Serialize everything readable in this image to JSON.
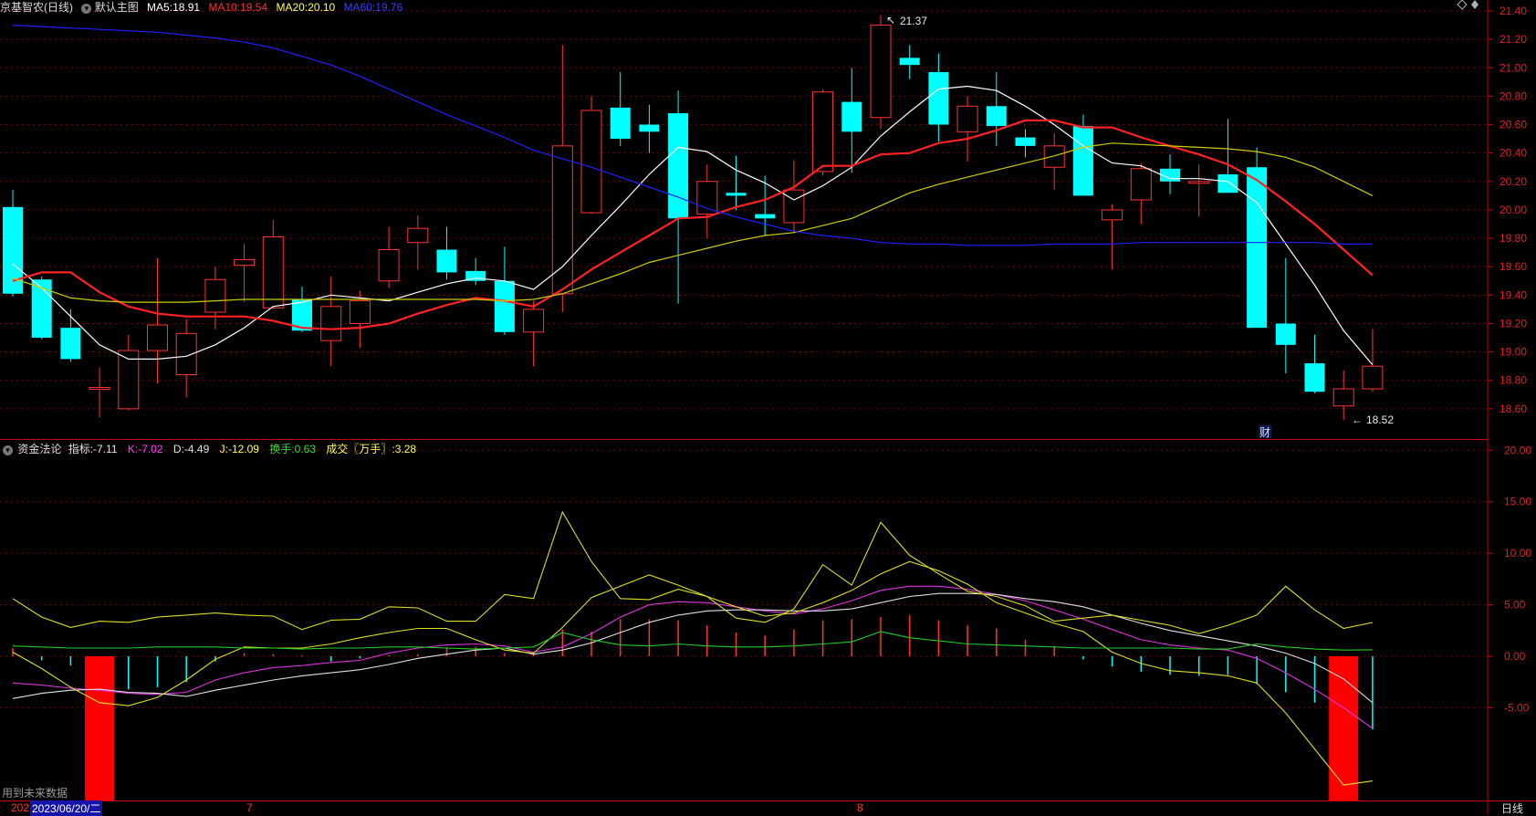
{
  "header": {
    "stock": "京基智农(日线)",
    "default_chart": "默认主图",
    "ma": [
      {
        "label": "MA5:",
        "value": "18.91",
        "color": "#ffffff"
      },
      {
        "label": "MA10:",
        "value": "19.54",
        "color": "#ff3030"
      },
      {
        "label": "MA20:",
        "value": "20.10",
        "color": "#ffff55"
      },
      {
        "label": "MA60:",
        "value": "19.76",
        "color": "#3a3aff"
      }
    ],
    "high_mark": "21.37",
    "low_mark": "18.52",
    "fin_badge": "财"
  },
  "indicator_header": {
    "name": "资金法论",
    "items": [
      {
        "label": "指标:",
        "value": "-7.11",
        "color": "#e0e0e0"
      },
      {
        "label": "K:",
        "value": "-7.02",
        "color": "#ff44ff"
      },
      {
        "label": "D:",
        "value": "-4.49",
        "color": "#e0e0e0"
      },
      {
        "label": "J:",
        "value": "-12.09",
        "color": "#ffff55"
      },
      {
        "label": "换手:",
        "value": "0.63",
        "color": "#33dd33"
      },
      {
        "label": "成交〖万手〗:",
        "value": "3.28",
        "color": "#ffff55"
      }
    ]
  },
  "footer": {
    "future_note": "用到未来数据",
    "cursor_date": "2023/06/20/二",
    "date_prefix": "202",
    "month_7": "7",
    "month_8": "8",
    "period": "日线"
  },
  "colors": {
    "up": "#ff3333",
    "down": "#00ffff",
    "grid": "#7a0000",
    "axis": "#cc0000",
    "label": "#dd2222"
  },
  "chart_data": [
    {
      "type": "candlestick",
      "ylim": [
        18.4,
        21.4
      ],
      "y_ticks": [
        "21.40",
        "21.20",
        "21.00",
        "20.80",
        "20.60",
        "20.40",
        "20.20",
        "20.00",
        "19.80",
        "19.60",
        "19.40",
        "19.20",
        "19.00",
        "18.80",
        "18.60"
      ],
      "ohlc": [
        [
          20.02,
          20.14,
          19.39,
          19.41
        ],
        [
          19.51,
          19.53,
          19.09,
          19.1
        ],
        [
          19.17,
          19.3,
          18.93,
          18.95
        ],
        [
          18.75,
          18.89,
          18.54,
          18.75
        ],
        [
          18.6,
          19.12,
          18.59,
          19.01
        ],
        [
          19.01,
          19.66,
          18.78,
          19.19
        ],
        [
          18.84,
          19.23,
          18.68,
          19.13
        ],
        [
          19.28,
          19.6,
          19.16,
          19.51
        ],
        [
          19.61,
          19.76,
          19.35,
          19.65
        ],
        [
          19.31,
          19.93,
          19.3,
          19.81
        ],
        [
          19.37,
          19.46,
          19.14,
          19.15
        ],
        [
          19.08,
          19.53,
          18.9,
          19.32
        ],
        [
          19.2,
          19.43,
          19.03,
          19.36
        ],
        [
          19.5,
          19.88,
          19.45,
          19.72
        ],
        [
          19.77,
          19.96,
          19.58,
          19.87
        ],
        [
          19.72,
          19.88,
          19.51,
          19.56
        ],
        [
          19.57,
          19.66,
          19.47,
          19.5
        ],
        [
          19.5,
          19.74,
          19.12,
          19.14
        ],
        [
          19.14,
          19.36,
          18.9,
          19.3
        ],
        [
          19.41,
          21.16,
          19.28,
          20.45
        ],
        [
          19.98,
          20.8,
          19.97,
          20.7
        ],
        [
          20.72,
          20.97,
          20.45,
          20.5
        ],
        [
          20.6,
          20.74,
          20.4,
          20.55
        ],
        [
          20.68,
          20.84,
          19.34,
          19.94
        ],
        [
          19.97,
          20.32,
          19.8,
          20.2
        ],
        [
          20.12,
          20.38,
          20.0,
          20.1
        ],
        [
          19.97,
          20.24,
          19.82,
          19.94
        ],
        [
          19.91,
          20.35,
          19.84,
          20.14
        ],
        [
          20.27,
          20.85,
          20.24,
          20.83
        ],
        [
          20.76,
          21.0,
          20.26,
          20.55
        ],
        [
          20.65,
          21.37,
          20.57,
          21.3
        ],
        [
          21.07,
          21.16,
          20.92,
          21.02
        ],
        [
          20.97,
          21.1,
          20.48,
          20.6
        ],
        [
          20.55,
          20.8,
          20.34,
          20.73
        ],
        [
          20.73,
          20.97,
          20.45,
          20.59
        ],
        [
          20.51,
          20.57,
          20.37,
          20.45
        ],
        [
          20.3,
          20.54,
          20.14,
          20.45
        ],
        [
          20.59,
          20.67,
          20.1,
          20.1
        ],
        [
          19.93,
          20.04,
          19.58,
          20.0
        ],
        [
          20.07,
          20.33,
          19.9,
          20.29
        ],
        [
          20.29,
          20.39,
          20.11,
          20.2
        ],
        [
          20.2,
          20.32,
          19.95,
          20.2
        ],
        [
          20.25,
          20.64,
          20.12,
          20.12
        ],
        [
          20.3,
          20.44,
          19.17,
          19.17
        ],
        [
          19.2,
          19.66,
          18.85,
          19.05
        ],
        [
          18.92,
          19.12,
          18.71,
          18.72
        ],
        [
          18.62,
          18.87,
          18.52,
          18.74
        ],
        [
          18.74,
          19.16,
          18.72,
          18.9
        ]
      ],
      "series": [
        {
          "name": "MA5",
          "color": "#ffffff",
          "values": [
            19.62,
            19.45,
            19.25,
            19.05,
            18.95,
            18.95,
            18.97,
            19.05,
            19.17,
            19.32,
            19.35,
            19.4,
            19.38,
            19.36,
            19.42,
            19.48,
            19.52,
            19.5,
            19.44,
            19.6,
            19.82,
            20.03,
            20.25,
            20.44,
            20.41,
            20.28,
            20.19,
            20.07,
            20.17,
            20.3,
            20.52,
            20.69,
            20.85,
            20.87,
            20.84,
            20.73,
            20.6,
            20.45,
            20.33,
            20.31,
            20.22,
            20.22,
            20.2,
            20.05,
            19.76,
            19.47,
            19.15,
            18.91
          ]
        },
        {
          "name": "MA10",
          "color": "#ff2222",
          "width": 2.2,
          "values": [
            19.5,
            19.56,
            19.56,
            19.42,
            19.32,
            19.27,
            19.25,
            19.25,
            19.25,
            19.22,
            19.17,
            19.16,
            19.17,
            19.2,
            19.27,
            19.33,
            19.38,
            19.36,
            19.32,
            19.44,
            19.58,
            19.7,
            19.82,
            19.94,
            19.95,
            20.02,
            20.07,
            20.16,
            20.31,
            20.31,
            20.39,
            20.4,
            20.47,
            20.5,
            20.56,
            20.63,
            20.63,
            20.58,
            20.58,
            20.51,
            20.45,
            20.39,
            20.32,
            20.21,
            20.06,
            19.9,
            19.72,
            19.54
          ]
        },
        {
          "name": "MA20",
          "color": "#cccc00",
          "values": [
            19.52,
            19.45,
            19.38,
            19.36,
            19.35,
            19.35,
            19.35,
            19.36,
            19.37,
            19.37,
            19.37,
            19.37,
            19.37,
            19.37,
            19.37,
            19.37,
            19.37,
            19.36,
            19.37,
            19.41,
            19.48,
            19.55,
            19.63,
            19.68,
            19.73,
            19.78,
            19.82,
            19.84,
            19.89,
            19.94,
            20.03,
            20.12,
            20.18,
            20.23,
            20.28,
            20.33,
            20.38,
            20.44,
            20.47,
            20.46,
            20.45,
            20.44,
            20.43,
            20.41,
            20.37,
            20.3,
            20.2,
            20.1
          ]
        },
        {
          "name": "MA60",
          "color": "#2020ff",
          "values": [
            21.3,
            21.29,
            21.28,
            21.27,
            21.26,
            21.25,
            21.23,
            21.21,
            21.18,
            21.14,
            21.08,
            21.02,
            20.94,
            20.85,
            20.76,
            20.67,
            20.59,
            20.51,
            20.42,
            20.36,
            20.3,
            20.23,
            20.16,
            20.09,
            20.01,
            19.95,
            19.9,
            19.85,
            19.82,
            19.8,
            19.77,
            19.76,
            19.76,
            19.75,
            19.75,
            19.75,
            19.76,
            19.76,
            19.76,
            19.77,
            19.77,
            19.77,
            19.77,
            19.77,
            19.77,
            19.77,
            19.76,
            19.76
          ]
        }
      ]
    },
    {
      "type": "indicator",
      "ylim": [
        -14,
        21
      ],
      "y_ticks": [
        "20.00",
        "15.00",
        "10.00",
        "5.00",
        "0.00",
        "-5.00"
      ],
      "signal_bars": [
        {
          "index": 3,
          "value": -14
        },
        {
          "index": 46,
          "value": -14
        }
      ],
      "sticks": [
        0.8,
        -0.4,
        -0.9,
        -2.2,
        -3.2,
        -3.0,
        -2.5,
        -0.5,
        0.3,
        0.2,
        0.1,
        -0.5,
        -0.2,
        0.1,
        0.2,
        0.9,
        0.9,
        0.3,
        0.3,
        2.6,
        2.4,
        3.6,
        3.6,
        3.5,
        3.0,
        2.3,
        2.0,
        2.6,
        3.5,
        3.6,
        3.8,
        4.0,
        3.5,
        3.0,
        2.7,
        1.6,
        1.0,
        -0.3,
        -1.0,
        -1.5,
        -1.8,
        -1.9,
        -1.8,
        -2.7,
        -3.5,
        -4.5,
        -5.7,
        -7.1
      ],
      "series": [
        {
          "name": "K",
          "color": "#dd33dd",
          "values": [
            -2.6,
            -2.8,
            -3.1,
            -3.3,
            -3.6,
            -3.7,
            -3.5,
            -2.3,
            -1.6,
            -1.1,
            -0.9,
            -0.6,
            -0.4,
            0.3,
            0.8,
            1.1,
            1.2,
            1.0,
            0.4,
            0.9,
            2.2,
            3.8,
            5.0,
            5.3,
            5.2,
            4.8,
            4.4,
            4.1,
            4.6,
            5.4,
            6.4,
            6.8,
            6.8,
            6.5,
            6.0,
            5.4,
            4.5,
            3.6,
            2.6,
            1.6,
            1.1,
            0.8,
            0.6,
            -0.2,
            -1.6,
            -3.2,
            -5.0,
            -7.0
          ]
        },
        {
          "name": "D",
          "color": "#e0e0e0",
          "values": [
            -4.1,
            -3.6,
            -3.3,
            -3.2,
            -3.5,
            -3.6,
            -3.9,
            -3.3,
            -2.8,
            -2.3,
            -1.9,
            -1.6,
            -1.3,
            -0.8,
            -0.2,
            0.2,
            0.6,
            0.8,
            0.2,
            0.6,
            1.3,
            2.3,
            3.3,
            4.0,
            4.4,
            4.5,
            4.5,
            4.4,
            4.4,
            4.6,
            5.2,
            5.8,
            6.1,
            6.1,
            6.0,
            5.6,
            5.3,
            4.8,
            4.0,
            3.2,
            2.5,
            2.0,
            1.5,
            1.0,
            0.3,
            -0.7,
            -2.2,
            -4.5
          ]
        },
        {
          "name": "J",
          "color": "#dddd22",
          "values": [
            0.4,
            -1.2,
            -3.0,
            -4.5,
            -4.8,
            -4.0,
            -2.3,
            -0.3,
            0.9,
            0.8,
            0.8,
            1.2,
            1.8,
            2.3,
            2.7,
            2.7,
            1.6,
            0.6,
            0.3,
            2.8,
            5.7,
            6.8,
            7.9,
            6.9,
            5.8,
            4.8,
            3.9,
            4.2,
            5.2,
            6.4,
            8.0,
            9.2,
            8.3,
            7.0,
            5.2,
            4.2,
            3.2,
            2.4,
            0.4,
            -0.7,
            -1.4,
            -1.6,
            -1.9,
            -2.6,
            -5.5,
            -9.0,
            -12.5,
            -12.1
          ]
        },
        {
          "name": "换手",
          "color": "#22cc22",
          "values": [
            1.0,
            0.9,
            0.8,
            0.8,
            0.8,
            0.9,
            0.9,
            0.9,
            0.8,
            0.8,
            0.7,
            0.8,
            0.8,
            0.9,
            0.9,
            0.8,
            0.7,
            0.8,
            0.9,
            2.3,
            1.6,
            1.1,
            1.0,
            1.2,
            1.0,
            0.9,
            0.9,
            1.0,
            1.2,
            1.4,
            2.4,
            1.8,
            1.5,
            1.2,
            1.1,
            1.0,
            0.9,
            0.8,
            0.8,
            0.8,
            0.8,
            0.7,
            0.7,
            1.2,
            0.9,
            0.7,
            0.6,
            0.63
          ]
        },
        {
          "name": "成交",
          "color": "#dddd22",
          "values": [
            5.6,
            3.8,
            2.8,
            3.4,
            3.3,
            3.8,
            4.0,
            4.2,
            4.0,
            3.9,
            2.6,
            3.5,
            3.6,
            4.8,
            4.7,
            3.4,
            3.4,
            6.0,
            5.6,
            14.0,
            9.2,
            5.6,
            5.5,
            6.5,
            5.8,
            3.7,
            3.3,
            4.6,
            8.9,
            6.9,
            13.0,
            9.8,
            8.0,
            6.3,
            5.8,
            4.9,
            3.4,
            3.7,
            4.0,
            3.5,
            3.0,
            2.2,
            3.0,
            4.0,
            6.8,
            4.5,
            2.7,
            3.28
          ]
        }
      ]
    }
  ]
}
